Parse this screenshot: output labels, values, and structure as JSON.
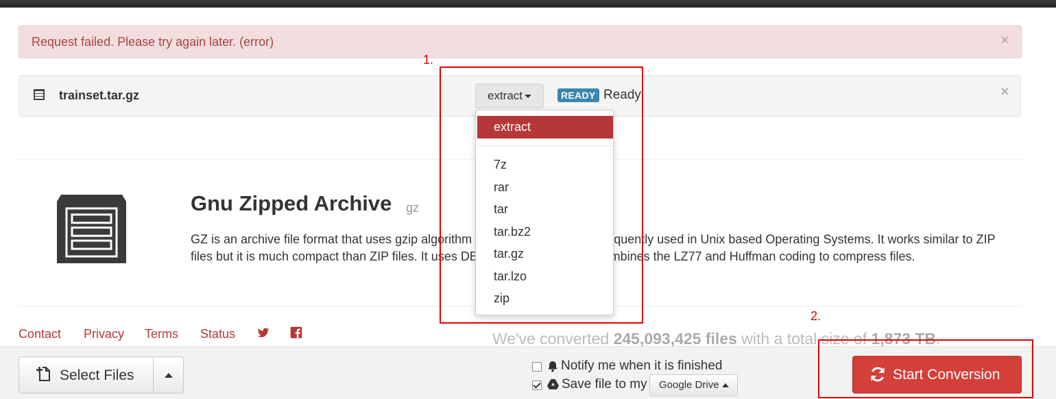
{
  "alert": {
    "message": "Request failed. Please try again later. (error)",
    "close": "×"
  },
  "file": {
    "name": "trainset.tar.gz",
    "format_selected": "extract",
    "status_badge": "READY",
    "status_text": "Ready",
    "close": "×"
  },
  "dropdown": {
    "active": "extract",
    "items": [
      "7z",
      "rar",
      "tar",
      "tar.bz2",
      "tar.gz",
      "tar.lzo",
      "zip"
    ]
  },
  "description": {
    "title": "Gnu Zipped Archive",
    "ext": "gz",
    "text": "GZ is an archive file format that uses gzip algorithm to compress data. It is frequently used in Unix based Operating Systems. It works similar to ZIP files but it is much compact than ZIP files. It uses DEFLATE algorithm and combines the LZ77 and Huffman coding to compress files."
  },
  "footer": {
    "links": [
      "Contact",
      "Privacy",
      "Terms",
      "Status"
    ],
    "social": [
      "twitter-icon",
      "facebook-icon"
    ]
  },
  "stats": {
    "prefix": "We've converted ",
    "files": "245,093,425 files",
    "middle": " with a total size of ",
    "size": "1,873 TB",
    "suffix": "."
  },
  "bottombar": {
    "select_files": "Select Files",
    "notify_label": "Notify me when it is finished",
    "notify_checked": false,
    "save_label": "Save file to my",
    "save_checked": true,
    "storage_option": "Google Drive",
    "start_button": "Start Conversion"
  },
  "annotations": {
    "label1": "1.",
    "label2": "2."
  },
  "colors": {
    "accent": "#b53737",
    "start": "#d43f3a",
    "badge": "#3a87ad",
    "alert_bg": "#f2dede",
    "annotation": "#e00000"
  }
}
